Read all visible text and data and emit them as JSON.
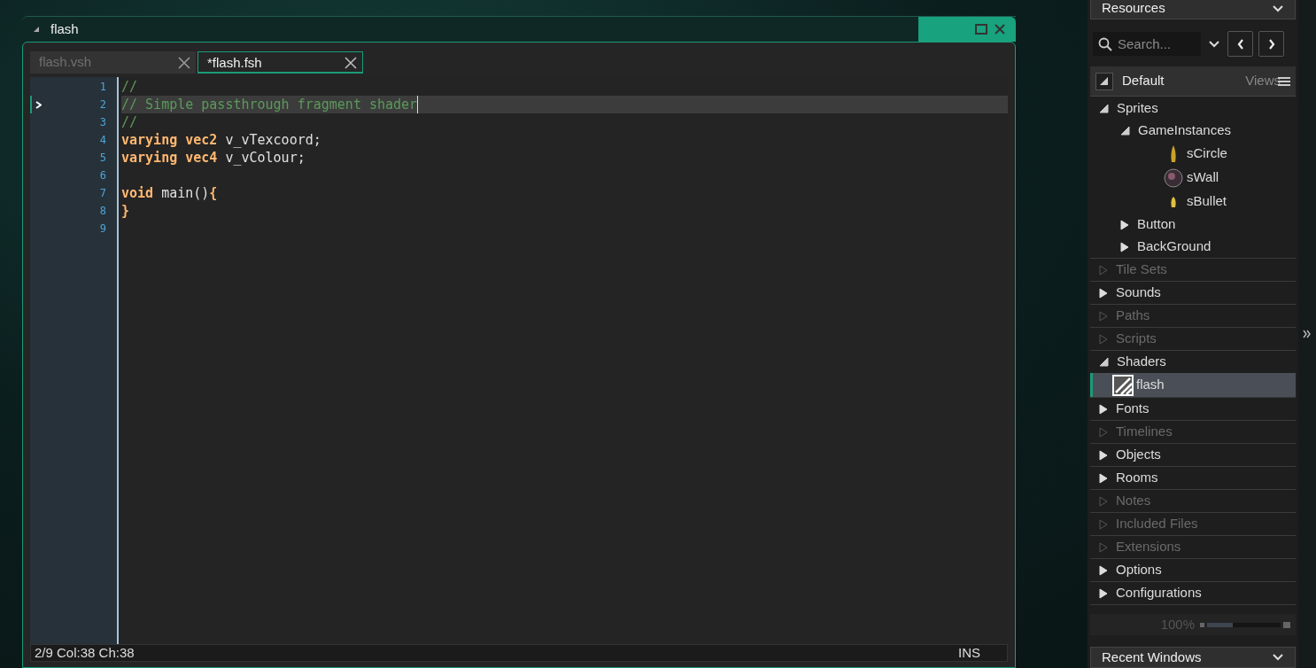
{
  "window": {
    "title": "flash"
  },
  "tabs": [
    {
      "label": "flash.vsh",
      "selected": false
    },
    {
      "label": "*flash.fsh",
      "selected": true
    }
  ],
  "editor": {
    "lines": [
      {
        "number": "1",
        "selected": false,
        "tokens": [
          {
            "text": "//",
            "kind": "comment"
          }
        ]
      },
      {
        "number": "2",
        "selected": true,
        "tokens": [
          {
            "text": "// Simple passthrough fragment shader",
            "kind": "comment"
          }
        ]
      },
      {
        "number": "3",
        "selected": false,
        "tokens": [
          {
            "text": "//",
            "kind": "comment"
          }
        ]
      },
      {
        "number": "4",
        "selected": false,
        "tokens": [
          {
            "text": "varying vec2",
            "kind": "keyword"
          },
          {
            "text": " v_vTexcoord;",
            "kind": "plain"
          }
        ]
      },
      {
        "number": "5",
        "selected": false,
        "tokens": [
          {
            "text": "varying vec4",
            "kind": "keyword"
          },
          {
            "text": " v_vColour;",
            "kind": "plain"
          }
        ]
      },
      {
        "number": "6",
        "selected": false
      },
      {
        "number": "7",
        "selected": false,
        "tokens": [
          {
            "text": "void",
            "kind": "keyword"
          },
          {
            "text": " main()",
            "kind": "plain"
          },
          {
            "text": "{",
            "kind": "keyword"
          }
        ]
      },
      {
        "number": "8",
        "selected": false,
        "tokens": [
          {
            "text": "}",
            "kind": "keyword"
          }
        ]
      },
      {
        "number": "9",
        "selected": false
      }
    ]
  },
  "status_bar": {
    "position": "2/9 Col:38 Ch:38",
    "mode": "INS"
  },
  "resources": {
    "title": "Resources",
    "search": {
      "placeholder": "Search..."
    },
    "view": "Default",
    "views_label": "Views",
    "tree": [
      {
        "label": "Sprites",
        "kind": "group",
        "expanded": true,
        "disabled": false,
        "children": [
          {
            "label": "GameInstances",
            "kind": "group",
            "expanded": true,
            "disabled": false,
            "children": [
              {
                "label": "sCircle",
                "kind": "flame",
                "selected": false
              },
              {
                "label": "sWall",
                "kind": "ball",
                "selected": false
              },
              {
                "label": "sBullet",
                "kind": "bullet",
                "selected": false
              }
            ]
          },
          {
            "label": "Button",
            "kind": "group",
            "expanded": false,
            "disabled": false
          },
          {
            "label": "BackGround",
            "kind": "group",
            "expanded": false,
            "disabled": false
          }
        ]
      },
      {
        "label": "Tile Sets",
        "kind": "group",
        "expanded": false,
        "disabled": true
      },
      {
        "label": "Sounds",
        "kind": "group",
        "expanded": false,
        "disabled": false
      },
      {
        "label": "Paths",
        "kind": "group",
        "expanded": false,
        "disabled": true
      },
      {
        "label": "Scripts",
        "kind": "group",
        "expanded": false,
        "disabled": true
      },
      {
        "label": "Shaders",
        "kind": "group",
        "expanded": true,
        "disabled": false,
        "children": [
          {
            "label": "flash",
            "kind": "shader",
            "selected": true
          }
        ]
      },
      {
        "label": "Fonts",
        "kind": "group",
        "expanded": false,
        "disabled": false
      },
      {
        "label": "Timelines",
        "kind": "group",
        "expanded": false,
        "disabled": true
      },
      {
        "label": "Objects",
        "kind": "group",
        "expanded": false,
        "disabled": false
      },
      {
        "label": "Rooms",
        "kind": "group",
        "expanded": false,
        "disabled": false
      },
      {
        "label": "Notes",
        "kind": "group",
        "expanded": false,
        "disabled": true
      },
      {
        "label": "Included Files",
        "kind": "group",
        "expanded": false,
        "disabled": true
      },
      {
        "label": "Extensions",
        "kind": "group",
        "expanded": false,
        "disabled": true
      },
      {
        "label": "Options",
        "kind": "group",
        "expanded": false,
        "disabled": false
      },
      {
        "label": "Configurations",
        "kind": "group",
        "expanded": false,
        "disabled": false
      }
    ],
    "zoom": {
      "reading": "100%",
      "level": 0.35
    }
  },
  "recent_windows": {
    "title": "Recent Windows"
  }
}
